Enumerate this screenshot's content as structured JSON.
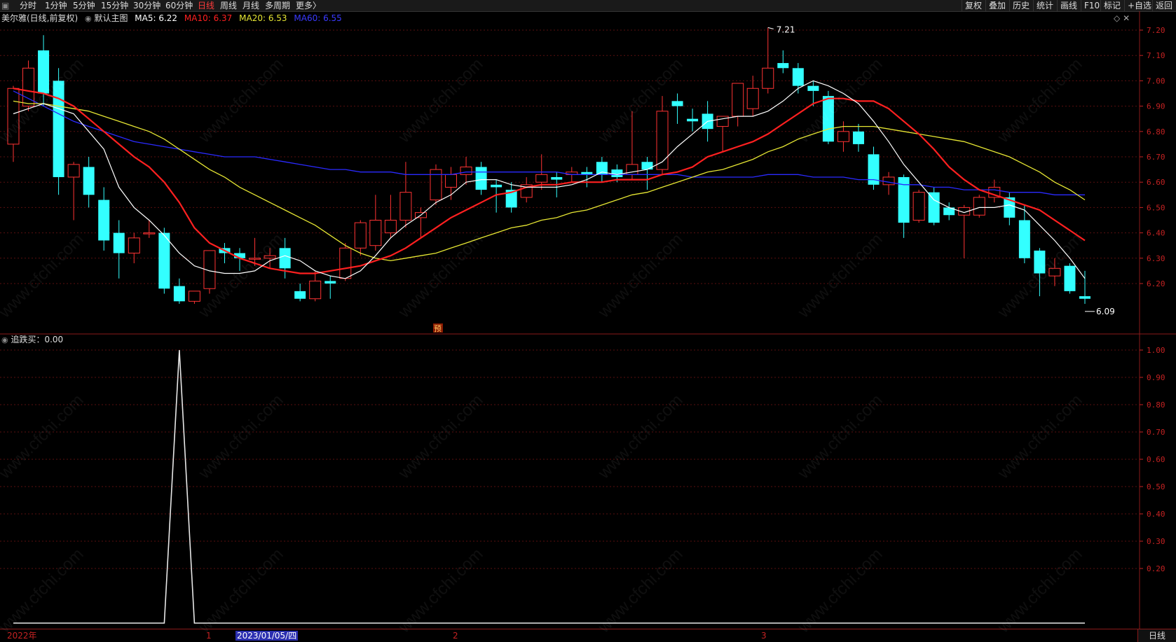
{
  "toolbar": {
    "left": [
      "分时",
      "1分钟",
      "5分钟",
      "15分钟",
      "30分钟",
      "60分钟",
      "日线",
      "周线",
      "月线",
      "多周期",
      "更多〉"
    ],
    "active": "日线",
    "right": [
      "复权",
      "叠加",
      "历史",
      "统计",
      "画线",
      "F10",
      "标记",
      "+自选",
      "返回"
    ]
  },
  "main_info": {
    "stock": "美尔雅(日线,前复权)",
    "template": "默认主图",
    "ma5": "MA5: 6.22",
    "ma10": "MA10: 6.37",
    "ma20": "MA20: 6.53",
    "ma60": "MA60: 6.55"
  },
  "sub_info": {
    "indicator": "追跌买：0.00"
  },
  "colors": {
    "up": "#ff3333",
    "down": "#33ffff",
    "ma5": "#ffffff",
    "ma10": "#ff2020",
    "ma20": "#e6e633",
    "ma60": "#2a2aff",
    "axis": "#c42222",
    "grid": "#5a0f0f"
  },
  "bottom_axis": {
    "year": "2022年",
    "m1": "1",
    "selected_date": "2023/01/05/四",
    "m2": "2",
    "m3": "3",
    "period_button": "日线"
  },
  "watermark": "www.cfchi.com",
  "markers": {
    "high_label": "7.21",
    "low_label": "6.09",
    "pre_badge": "预"
  },
  "chart_data": [
    {
      "type": "candlestick",
      "title": "美尔雅(日线,前复权)",
      "ylim": [
        6.1,
        7.25
      ],
      "y_ticks": [
        "7.20",
        "7.10",
        "7.00",
        "6.90",
        "6.80",
        "6.70",
        "6.60",
        "6.50",
        "6.40",
        "6.30",
        "6.20"
      ],
      "candles": [
        [
          6.75,
          6.98,
          6.97,
          6.68
        ],
        [
          6.9,
          7.08,
          7.05,
          6.88
        ],
        [
          7.12,
          7.18,
          6.95,
          6.9
        ],
        [
          7.0,
          7.05,
          6.62,
          6.55
        ],
        [
          6.62,
          6.68,
          6.67,
          6.45
        ],
        [
          6.66,
          6.7,
          6.55,
          6.5
        ],
        [
          6.53,
          6.58,
          6.37,
          6.33
        ],
        [
          6.4,
          6.45,
          6.32,
          6.22
        ],
        [
          6.32,
          6.4,
          6.38,
          6.28
        ],
        [
          6.4,
          6.45,
          6.4,
          6.38
        ],
        [
          6.4,
          6.42,
          6.18,
          6.16
        ],
        [
          6.19,
          6.22,
          6.13,
          6.12
        ],
        [
          6.13,
          6.17,
          6.17,
          6.12
        ],
        [
          6.18,
          6.33,
          6.33,
          6.16
        ],
        [
          6.34,
          6.36,
          6.32,
          6.28
        ],
        [
          6.32,
          6.34,
          6.3,
          6.25
        ],
        [
          6.3,
          6.38,
          6.3,
          6.27
        ],
        [
          6.3,
          6.34,
          6.31,
          6.26
        ],
        [
          6.34,
          6.38,
          6.26,
          6.22
        ],
        [
          6.17,
          6.2,
          6.14,
          6.13
        ],
        [
          6.14,
          6.25,
          6.21,
          6.13
        ],
        [
          6.21,
          6.23,
          6.2,
          6.14
        ],
        [
          6.22,
          6.36,
          6.34,
          6.21
        ],
        [
          6.34,
          6.45,
          6.44,
          6.31
        ],
        [
          6.35,
          6.55,
          6.45,
          6.33
        ],
        [
          6.4,
          6.55,
          6.45,
          6.38
        ],
        [
          6.45,
          6.68,
          6.56,
          6.42
        ],
        [
          6.46,
          6.5,
          6.48,
          6.38
        ],
        [
          6.53,
          6.67,
          6.65,
          6.51
        ],
        [
          6.58,
          6.66,
          6.63,
          6.53
        ],
        [
          6.63,
          6.7,
          6.66,
          6.59
        ],
        [
          6.66,
          6.68,
          6.57,
          6.55
        ],
        [
          6.59,
          6.61,
          6.58,
          6.48
        ],
        [
          6.57,
          6.6,
          6.5,
          6.48
        ],
        [
          6.54,
          6.62,
          6.59,
          6.52
        ],
        [
          6.6,
          6.71,
          6.63,
          6.57
        ],
        [
          6.62,
          6.64,
          6.61,
          6.54
        ],
        [
          6.63,
          6.66,
          6.64,
          6.6
        ],
        [
          6.64,
          6.66,
          6.63,
          6.58
        ],
        [
          6.68,
          6.7,
          6.63,
          6.6
        ],
        [
          6.65,
          6.67,
          6.62,
          6.6
        ],
        [
          6.63,
          6.88,
          6.67,
          6.61
        ],
        [
          6.68,
          6.7,
          6.65,
          6.57
        ],
        [
          6.65,
          6.94,
          6.88,
          6.63
        ],
        [
          6.92,
          6.95,
          6.9,
          6.83
        ],
        [
          6.85,
          6.89,
          6.84,
          6.8
        ],
        [
          6.87,
          6.92,
          6.81,
          6.76
        ],
        [
          6.82,
          6.85,
          6.86,
          6.72
        ],
        [
          6.86,
          6.94,
          6.99,
          6.82
        ],
        [
          6.89,
          7.02,
          6.97,
          6.86
        ],
        [
          6.97,
          7.21,
          7.05,
          6.95
        ],
        [
          7.07,
          7.12,
          7.05,
          7.03
        ],
        [
          7.05,
          7.07,
          6.98,
          6.95
        ],
        [
          6.98,
          7.0,
          6.96,
          6.9
        ],
        [
          6.94,
          6.96,
          6.76,
          6.75
        ],
        [
          6.76,
          6.84,
          6.8,
          6.72
        ],
        [
          6.8,
          6.83,
          6.75,
          6.72
        ],
        [
          6.71,
          6.74,
          6.59,
          6.57
        ],
        [
          6.59,
          6.64,
          6.62,
          6.55
        ],
        [
          6.62,
          6.63,
          6.44,
          6.38
        ],
        [
          6.45,
          6.57,
          6.56,
          6.44
        ],
        [
          6.56,
          6.58,
          6.44,
          6.43
        ],
        [
          6.5,
          6.52,
          6.47,
          6.45
        ],
        [
          6.47,
          6.51,
          6.5,
          6.3
        ],
        [
          6.47,
          6.55,
          6.54,
          6.46
        ],
        [
          6.54,
          6.61,
          6.58,
          6.52
        ],
        [
          6.54,
          6.56,
          6.46,
          6.43
        ],
        [
          6.45,
          6.51,
          6.3,
          6.28
        ],
        [
          6.33,
          6.34,
          6.24,
          6.15
        ],
        [
          6.23,
          6.3,
          6.26,
          6.19
        ],
        [
          6.27,
          6.28,
          6.17,
          6.16
        ],
        [
          6.15,
          6.25,
          6.14,
          6.12
        ]
      ],
      "ma5": [
        6.87,
        6.89,
        6.91,
        6.89,
        6.87,
        6.8,
        6.73,
        6.58,
        6.5,
        6.45,
        6.39,
        6.32,
        6.27,
        6.25,
        6.24,
        6.24,
        6.25,
        6.29,
        6.31,
        6.29,
        6.25,
        6.23,
        6.22,
        6.25,
        6.31,
        6.38,
        6.43,
        6.47,
        6.52,
        6.55,
        6.6,
        6.61,
        6.61,
        6.59,
        6.58,
        6.58,
        6.58,
        6.59,
        6.61,
        6.64,
        6.63,
        6.64,
        6.65,
        6.68,
        6.74,
        6.79,
        6.84,
        6.85,
        6.86,
        6.86,
        6.88,
        6.92,
        6.97,
        7.0,
        6.98,
        6.95,
        6.91,
        6.84,
        6.76,
        6.67,
        6.6,
        6.53,
        6.5,
        6.48,
        6.5,
        6.5,
        6.51,
        6.49,
        6.43,
        6.37,
        6.3,
        6.22
      ],
      "ma10": [
        6.97,
        6.96,
        6.95,
        6.93,
        6.9,
        6.85,
        6.8,
        6.75,
        6.7,
        6.66,
        6.6,
        6.52,
        6.42,
        6.36,
        6.33,
        6.3,
        6.28,
        6.26,
        6.25,
        6.24,
        6.24,
        6.25,
        6.26,
        6.27,
        6.29,
        6.31,
        6.34,
        6.38,
        6.42,
        6.46,
        6.49,
        6.52,
        6.55,
        6.56,
        6.58,
        6.59,
        6.59,
        6.6,
        6.6,
        6.6,
        6.61,
        6.61,
        6.61,
        6.63,
        6.64,
        6.66,
        6.7,
        6.72,
        6.74,
        6.76,
        6.79,
        6.83,
        6.87,
        6.91,
        6.93,
        6.93,
        6.92,
        6.92,
        6.89,
        6.84,
        6.79,
        6.73,
        6.66,
        6.61,
        6.57,
        6.55,
        6.53,
        6.51,
        6.49,
        6.45,
        6.41,
        6.37
      ],
      "ma20": [
        6.92,
        6.91,
        6.91,
        6.9,
        6.89,
        6.88,
        6.86,
        6.84,
        6.82,
        6.8,
        6.77,
        6.73,
        6.69,
        6.65,
        6.62,
        6.58,
        6.55,
        6.52,
        6.49,
        6.46,
        6.43,
        6.39,
        6.35,
        6.32,
        6.3,
        6.29,
        6.3,
        6.31,
        6.32,
        6.34,
        6.36,
        6.38,
        6.4,
        6.42,
        6.43,
        6.45,
        6.46,
        6.48,
        6.49,
        6.51,
        6.53,
        6.55,
        6.56,
        6.58,
        6.6,
        6.62,
        6.64,
        6.65,
        6.67,
        6.69,
        6.72,
        6.74,
        6.77,
        6.79,
        6.81,
        6.82,
        6.82,
        6.82,
        6.81,
        6.8,
        6.79,
        6.78,
        6.77,
        6.76,
        6.74,
        6.72,
        6.7,
        6.67,
        6.64,
        6.6,
        6.57,
        6.53
      ],
      "ma60": [
        6.96,
        6.93,
        6.9,
        6.87,
        6.84,
        6.82,
        6.8,
        6.78,
        6.76,
        6.75,
        6.74,
        6.73,
        6.72,
        6.71,
        6.7,
        6.7,
        6.7,
        6.69,
        6.68,
        6.67,
        6.66,
        6.65,
        6.65,
        6.64,
        6.64,
        6.64,
        6.63,
        6.63,
        6.63,
        6.63,
        6.64,
        6.64,
        6.64,
        6.64,
        6.64,
        6.64,
        6.64,
        6.63,
        6.63,
        6.63,
        6.63,
        6.63,
        6.63,
        6.63,
        6.63,
        6.62,
        6.62,
        6.62,
        6.62,
        6.62,
        6.63,
        6.63,
        6.63,
        6.62,
        6.62,
        6.62,
        6.61,
        6.61,
        6.6,
        6.59,
        6.59,
        6.58,
        6.58,
        6.57,
        6.57,
        6.57,
        6.56,
        6.56,
        6.56,
        6.55,
        6.55,
        6.55
      ]
    },
    {
      "type": "line",
      "title": "追跌买",
      "ylim": [
        0,
        1.0
      ],
      "y_ticks": [
        "1.00",
        "0.90",
        "0.80",
        "0.70",
        "0.60",
        "0.50",
        "0.40",
        "0.30",
        "0.20"
      ],
      "values": [
        0,
        0,
        0,
        0,
        0,
        0,
        0,
        0,
        0,
        0,
        0,
        1,
        0,
        0,
        0,
        0,
        0,
        0,
        0,
        0,
        0,
        0,
        0,
        0,
        0,
        0,
        0,
        0,
        0,
        0,
        0,
        0,
        0,
        0,
        0,
        0,
        0,
        0,
        0,
        0,
        0,
        0,
        0,
        0,
        0,
        0,
        0,
        0,
        0,
        0,
        0,
        0,
        0,
        0,
        0,
        0,
        0,
        0,
        0,
        0,
        0,
        0,
        0,
        0,
        0,
        0,
        0,
        0,
        0,
        0,
        0,
        0
      ]
    }
  ]
}
